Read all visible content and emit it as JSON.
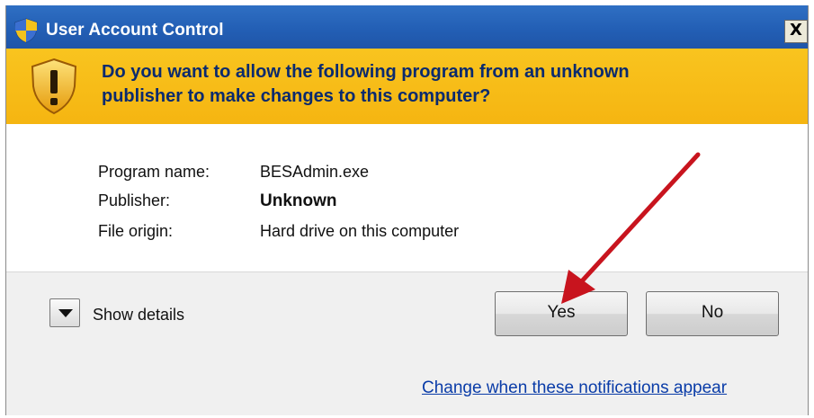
{
  "window": {
    "title": "User Account Control",
    "close_label": "X"
  },
  "banner": {
    "question_line1": "Do you want to allow the following program from an unknown",
    "question_line2": "publisher to make changes to this computer?"
  },
  "info": {
    "rows": [
      {
        "label": "Program name:",
        "value": "BESAdmin.exe"
      },
      {
        "label": "Publisher:",
        "value": "Unknown"
      },
      {
        "label": "File origin:",
        "value": "Hard drive on this computer"
      }
    ]
  },
  "footer": {
    "details_label": "Show details",
    "yes_label": "Yes",
    "no_label": "No",
    "change_link": "Change when these notifications appear"
  },
  "icons": {
    "title_icon": "uac-shield-icon",
    "banner_icon": "warning-shield-icon",
    "details_icon": "chevron-down-icon",
    "annotation": "red-arrow-icon"
  },
  "colors": {
    "titlebar": "#235fb5",
    "banner": "#f7bd16",
    "question_text": "#0a2a6e",
    "link": "#0a3ca8",
    "annotation_arrow": "#c8141e"
  }
}
